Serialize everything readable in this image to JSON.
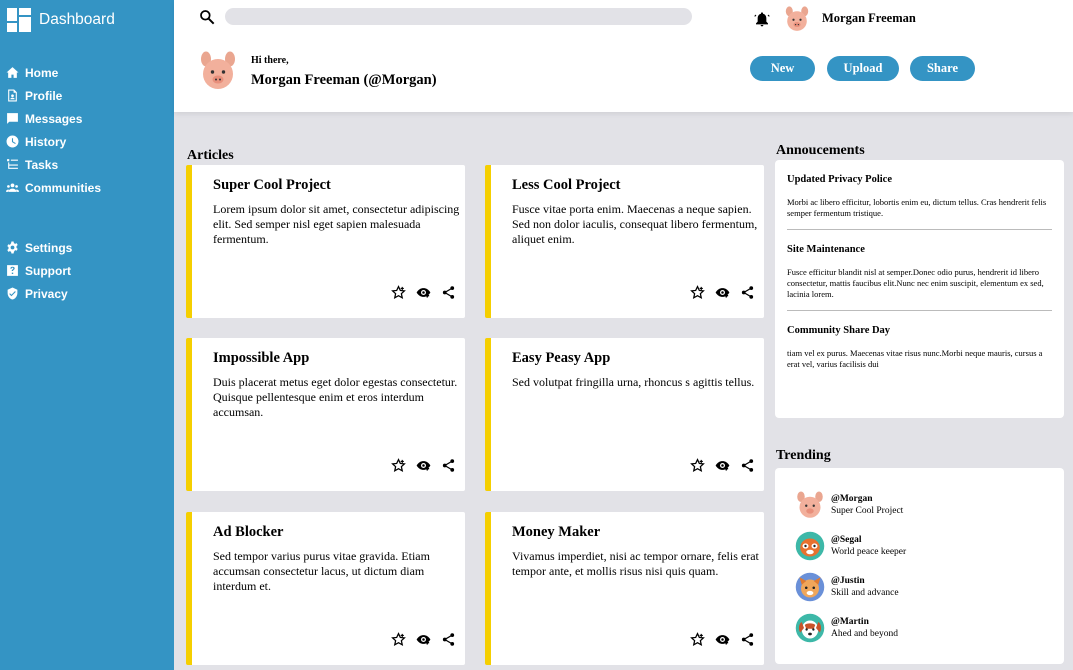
{
  "sidebar": {
    "brand": "Dashboard",
    "main_items": [
      {
        "label": "Home",
        "icon": "home-icon"
      },
      {
        "label": "Profile",
        "icon": "profile-icon"
      },
      {
        "label": "Messages",
        "icon": "messages-icon"
      },
      {
        "label": "History",
        "icon": "history-icon"
      },
      {
        "label": "Tasks",
        "icon": "tasks-icon"
      },
      {
        "label": "Communities",
        "icon": "communities-icon"
      }
    ],
    "secondary_items": [
      {
        "label": "Settings",
        "icon": "settings-icon"
      },
      {
        "label": "Support",
        "icon": "support-icon"
      },
      {
        "label": "Privacy",
        "icon": "privacy-icon"
      }
    ]
  },
  "header": {
    "search_placeholder": "",
    "username": "Morgan Freeman",
    "greeting": "Hi there,",
    "greeting_name": "Morgan Freeman (@Morgan)",
    "buttons": {
      "new": "New",
      "upload": "Upload",
      "share": "Share"
    }
  },
  "articles": {
    "title": "Articles",
    "cards": [
      {
        "title": "Super Cool Project",
        "body": "Lorem ipsum dolor sit amet, consectetur adipiscing elit. Sed semper nisl eget sapien malesuada fermentum."
      },
      {
        "title": "Less Cool Project",
        "body": "Fusce vitae porta enim. Maecenas a neque sapien. Sed non dolor iaculis, consequat libero fermentum, aliquet enim."
      },
      {
        "title": "Impossible App",
        "body": "Duis placerat metus eget dolor egestas consectetur. Quisque pellentesque enim et eros interdum accumsan."
      },
      {
        "title": "Easy Peasy App",
        "body": "Sed volutpat fringilla urna, rhoncus s agittis tellus."
      },
      {
        "title": "Ad Blocker",
        "body": "Sed tempor varius purus vitae gravida. Etiam accumsan consectetur lacus, ut dictum diam interdum et."
      },
      {
        "title": "Money Maker",
        "body": "Vivamus imperdiet, nisi ac tempor ornare, felis erat tempor ante, et mollis risus nisi quis quam."
      }
    ]
  },
  "announcements": {
    "title": "Annoucements",
    "items": [
      {
        "title": "Updated Privacy Police",
        "text": "Morbi ac libero efficitur, lobortis enim eu, dictum tellus. Cras hendrerit felis semper fermentum tristique."
      },
      {
        "title": "Site Maintenance",
        "text": "Fusce efficitur blandit nisl at semper.Donec odio purus, hendrerit id libero consectetur, mattis faucibus elit.Nunc nec enim suscipit, elementum ex sed, lacinia lorem."
      },
      {
        "title": "Community Share Day",
        "text": "tiam vel ex purus. Maecenas vitae risus nunc.Morbi neque mauris, cursus a erat vel, varius facilisis dui"
      }
    ]
  },
  "trending": {
    "title": "Trending",
    "items": [
      {
        "handle": "@Morgan",
        "desc": "Super Cool Project"
      },
      {
        "handle": "@Segal",
        "desc": "World peace keeper"
      },
      {
        "handle": "@Justin",
        "desc": "Skill and advance"
      },
      {
        "handle": "@Martin",
        "desc": "Ahed and beyond"
      }
    ]
  },
  "colors": {
    "sidebar": "#3494c4",
    "accent": "#f5cf00",
    "background": "#e2e2e7"
  }
}
